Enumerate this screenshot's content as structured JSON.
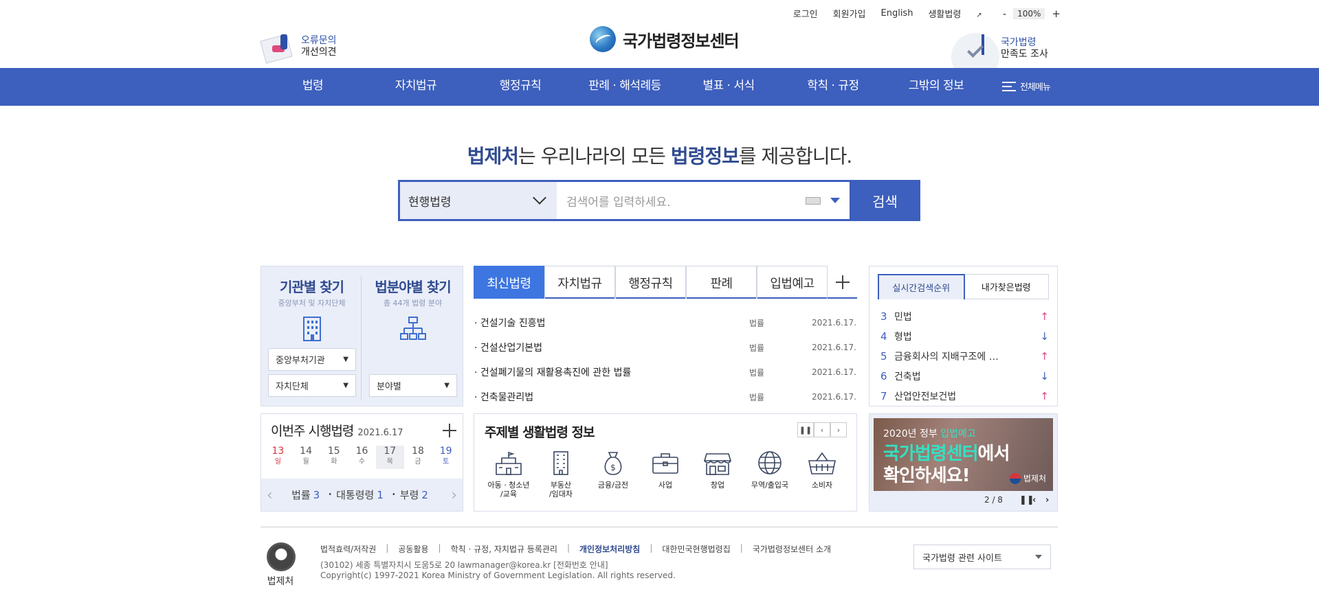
{
  "utility": {
    "login": "로그인",
    "signup": "회원가입",
    "english": "English",
    "life_law": "생활법령",
    "zoom_minus": "-",
    "zoom_value": "100%",
    "zoom_plus": "+"
  },
  "header": {
    "logo_text": "국가법령정보센터",
    "left_promo": {
      "line1": "오류문의",
      "line2": "개선의견"
    },
    "right_promo": {
      "line1": "국가법령",
      "line2": "만족도 조사"
    }
  },
  "nav": {
    "items": [
      "법령",
      "자치법규",
      "행정규칙",
      "판례 · 해석례등",
      "별표 · 서식",
      "학칙 · 규정",
      "그밖의 정보"
    ],
    "all_menu": "전체메뉴"
  },
  "hero": {
    "part1": "법제처",
    "part2": "는 우리나라의 모든 ",
    "part3": "법령정보",
    "part4": "를 제공합니다."
  },
  "search": {
    "category": "현행법령",
    "placeholder": "검색어를 입력하세요.",
    "button": "검색"
  },
  "finder": {
    "agency": {
      "title": "기관별 찾기",
      "subtitle": "중앙부처 및 자치단체",
      "select1": "중앙부처기관",
      "select2": "자치단체"
    },
    "field": {
      "title": "법분야별 찾기",
      "subtitle": "총 44개 법령 분야",
      "select": "분야별"
    }
  },
  "weekly": {
    "title": "이번주 시행법령",
    "date": "2021.6.17",
    "days": [
      {
        "num": "13",
        "label": "일"
      },
      {
        "num": "14",
        "label": "월"
      },
      {
        "num": "15",
        "label": "화"
      },
      {
        "num": "16",
        "label": "수"
      },
      {
        "num": "17",
        "label": "목"
      },
      {
        "num": "18",
        "label": "금"
      },
      {
        "num": "19",
        "label": "토"
      }
    ],
    "summary": {
      "law_label": "법률",
      "law_count": "3",
      "decree_label": "대통령령",
      "decree_count": "1",
      "ordinance_label": "부령",
      "ordinance_count": "2"
    }
  },
  "latest": {
    "tabs": [
      "최신법령",
      "자치법규",
      "행정규칙",
      "판례",
      "입법예고"
    ],
    "rows": [
      {
        "name": "· 건설기술 진흥법",
        "kind": "법률",
        "date": "2021.6.17."
      },
      {
        "name": "· 건설산업기본법",
        "kind": "법률",
        "date": "2021.6.17."
      },
      {
        "name": "· 건설폐기물의 재활용촉진에 관한 법률",
        "kind": "법률",
        "date": "2021.6.17."
      },
      {
        "name": "· 건축물관리법",
        "kind": "법률",
        "date": "2021.6.17."
      }
    ]
  },
  "themes": {
    "title": "주제별 생활법령 정보",
    "items": [
      {
        "label1": "아동 · 청소년",
        "label2": "/교육"
      },
      {
        "label1": "부동산",
        "label2": "/임대차"
      },
      {
        "label1": "금융/금전",
        "label2": ""
      },
      {
        "label1": "사업",
        "label2": ""
      },
      {
        "label1": "창업",
        "label2": ""
      },
      {
        "label1": "무역/출입국",
        "label2": ""
      },
      {
        "label1": "소비자",
        "label2": ""
      }
    ]
  },
  "ranking": {
    "tabs": [
      "실시간검색순위",
      "내가찾은법령"
    ],
    "rows": [
      {
        "num": "3",
        "name": "민법",
        "trend": "up"
      },
      {
        "num": "4",
        "name": "형법",
        "trend": "down"
      },
      {
        "num": "5",
        "name": "금융회사의 지배구조에 …",
        "trend": "up"
      },
      {
        "num": "6",
        "name": "건축법",
        "trend": "down"
      },
      {
        "num": "7",
        "name": "산업안전보건법",
        "trend": "up"
      }
    ]
  },
  "banner": {
    "line1_a": "2020년 정부 ",
    "line1_b": "입법예고",
    "line2_a": "국가법령센터",
    "line2_b": "에서",
    "line3": "확인하세요!",
    "mark": "법제처",
    "page": "2 / 8"
  },
  "footer": {
    "logo_text": "법제처",
    "links": [
      "법적효력/저작권",
      "공동활용",
      "학칙 · 규정, 자치법규 등록관리",
      "개인정보처리방침",
      "대한민국현행법령집",
      "국가법령정보센터 소개"
    ],
    "address": "(30102) 세종 특별자치시 도움5로 20 lawmanager@korea.kr [전화번호 안내]",
    "copyright": "Copyright(c) 1997-2021 Korea Ministry of Government Legislation. All rights reserved.",
    "related_sites": "국가법령 관련 사이트"
  },
  "colors": {
    "primary": "#3d5fbd",
    "tab_active": "#3d76e0",
    "up": "#e0478a",
    "panel_bg": "#eaeef8"
  }
}
